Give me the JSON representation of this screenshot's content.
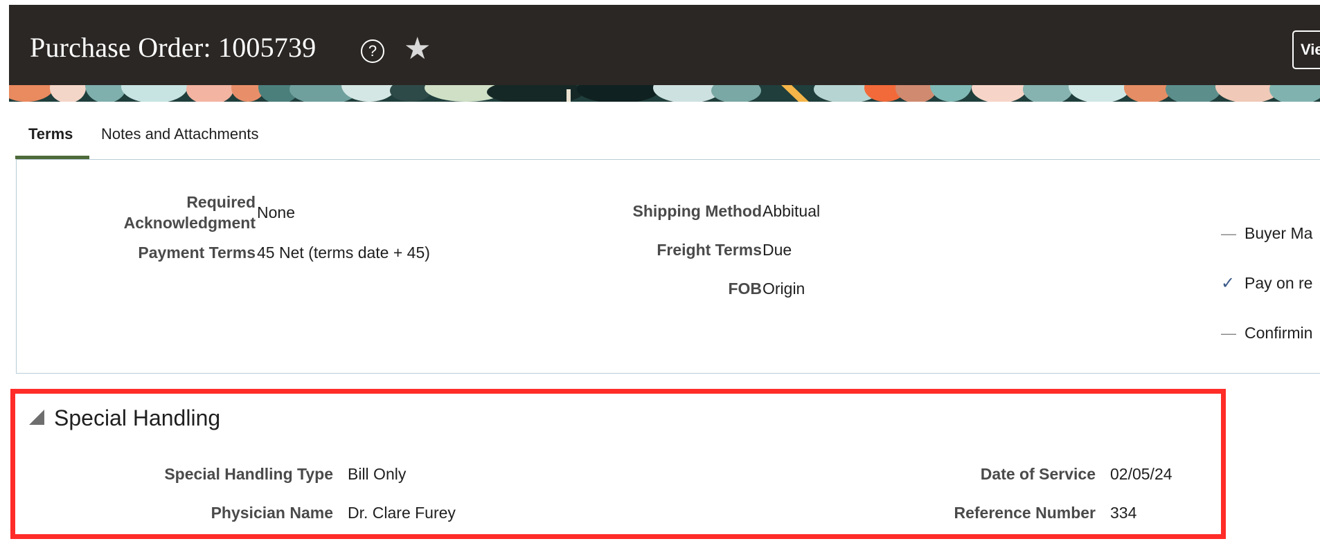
{
  "header": {
    "title": "Purchase Order: 1005739",
    "help_icon": "help-icon",
    "favorite_icon": "star-icon",
    "help_glyph": "?",
    "star_glyph": "★",
    "view_button_label": "View"
  },
  "tabs": [
    {
      "label": "Terms",
      "selected": true
    },
    {
      "label": "Notes and Attachments",
      "selected": false
    }
  ],
  "terms": {
    "required_ack_label_line1": "Required",
    "required_ack_label_line2": "Acknowledgment",
    "required_ack_value": "None",
    "payment_terms_label": "Payment Terms",
    "payment_terms_value": "45 Net (terms date + 45)",
    "shipping_method_label": "Shipping Method",
    "shipping_method_value": "Abbitual",
    "freight_terms_label": "Freight Terms",
    "freight_terms_value": "Due",
    "fob_label": "FOB",
    "fob_value": "Origin",
    "checks": [
      {
        "label": "Buyer Ma",
        "checked": false
      },
      {
        "label": "Pay on re",
        "checked": true
      },
      {
        "label": "Confirmin",
        "checked": false
      }
    ]
  },
  "special_handling": {
    "title": "Special Handling",
    "type_label": "Special Handling Type",
    "type_value": "Bill Only",
    "physician_label": "Physician Name",
    "physician_value": "Dr. Clare Furey",
    "date_label": "Date of Service",
    "date_value": "02/05/24",
    "reference_label": "Reference Number",
    "reference_value": "334"
  },
  "colors": {
    "header_bg": "#2b2724",
    "tab_accent": "#4e6b3a",
    "highlight_border": "#ff2c28",
    "panel_border": "#b8ccd8"
  }
}
